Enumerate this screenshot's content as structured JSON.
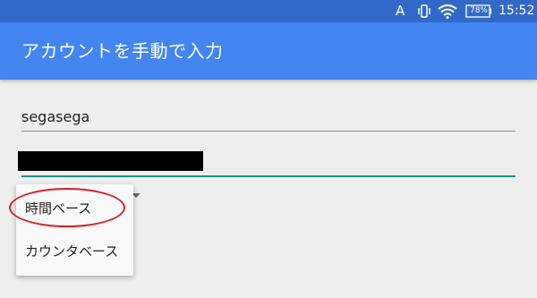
{
  "status_bar": {
    "indicator": "A",
    "icons": [
      "vibrate-icon",
      "wifi-icon",
      "battery-icon"
    ],
    "battery_level": "78%",
    "time": "15:52"
  },
  "app_bar": {
    "title": "アカウントを手動で入力"
  },
  "form": {
    "username_value": "segasega",
    "password_redacted": true
  },
  "dropdown": {
    "options": [
      "時間ベース",
      "カウンタベース"
    ],
    "highlighted": "時間ベース"
  },
  "colors": {
    "status_bar": "#3269c9",
    "app_bar": "#4386f1",
    "focus_underline": "#009688",
    "highlight_ring": "#d61f2b",
    "background": "#eeeeee"
  }
}
